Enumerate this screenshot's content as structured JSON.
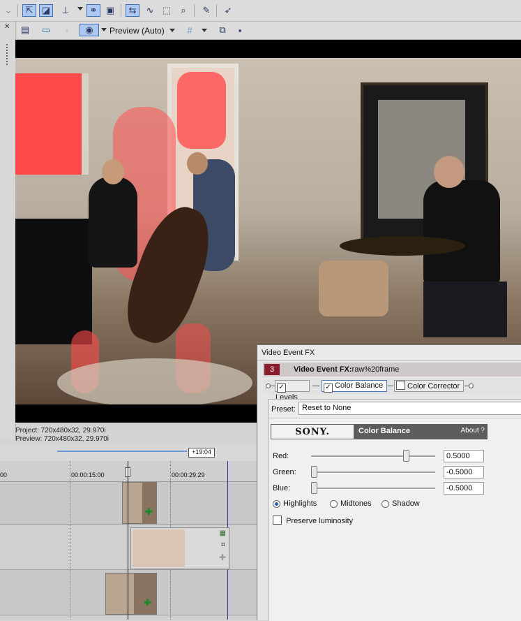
{
  "toolbar": {
    "icons": [
      "move-tool-icon",
      "selection-tool-icon",
      "snap-icon",
      "ripple-icon",
      "auto-crossfade-icon",
      "envelope-icon",
      "zoom-icon",
      "split-icon",
      "trim-icon",
      "ignore-grouping-icon"
    ]
  },
  "preview_toolbar": {
    "quality_label": "Preview (Auto)"
  },
  "preview_status": {
    "project": "Project:  720x480x32, 29.970i",
    "preview": "Preview:  720x480x32, 29.970i"
  },
  "timeline": {
    "loop_region": "+19:04",
    "ticks": [
      "00",
      "00:00:15:00",
      "00:00:29:29"
    ]
  },
  "fx_window": {
    "title": "Video Event FX",
    "badge": "3",
    "header_label": "Video Event FX:",
    "header_value": "raw%20frame",
    "chain": [
      {
        "label": "Levels",
        "checked": true
      },
      {
        "label": "Color Balance",
        "checked": true
      },
      {
        "label": "Color Corrector",
        "checked": false
      }
    ],
    "preset_label": "Preset:",
    "preset_value": "Reset to None",
    "brand": "SONY.",
    "plugin_name": "Color Balance",
    "about": "About  ?",
    "params": [
      {
        "label": "Red:",
        "value": "0.5000",
        "level": 0.75
      },
      {
        "label": "Green:",
        "value": "-0.5000",
        "level": 0.0
      },
      {
        "label": "Blue:",
        "value": "-0.5000",
        "level": 0.0
      }
    ],
    "tone_options": [
      {
        "label": "Highlights",
        "selected": true
      },
      {
        "label": "Midtones",
        "selected": false
      },
      {
        "label": "Shadow",
        "selected": false
      }
    ],
    "preserve_label": "Preserve luminosity",
    "preserve_checked": false
  },
  "colors": {
    "accent": "#3d6fb5",
    "badge": "#8b1e2c",
    "timeline_bar": "#1a1a8c"
  }
}
